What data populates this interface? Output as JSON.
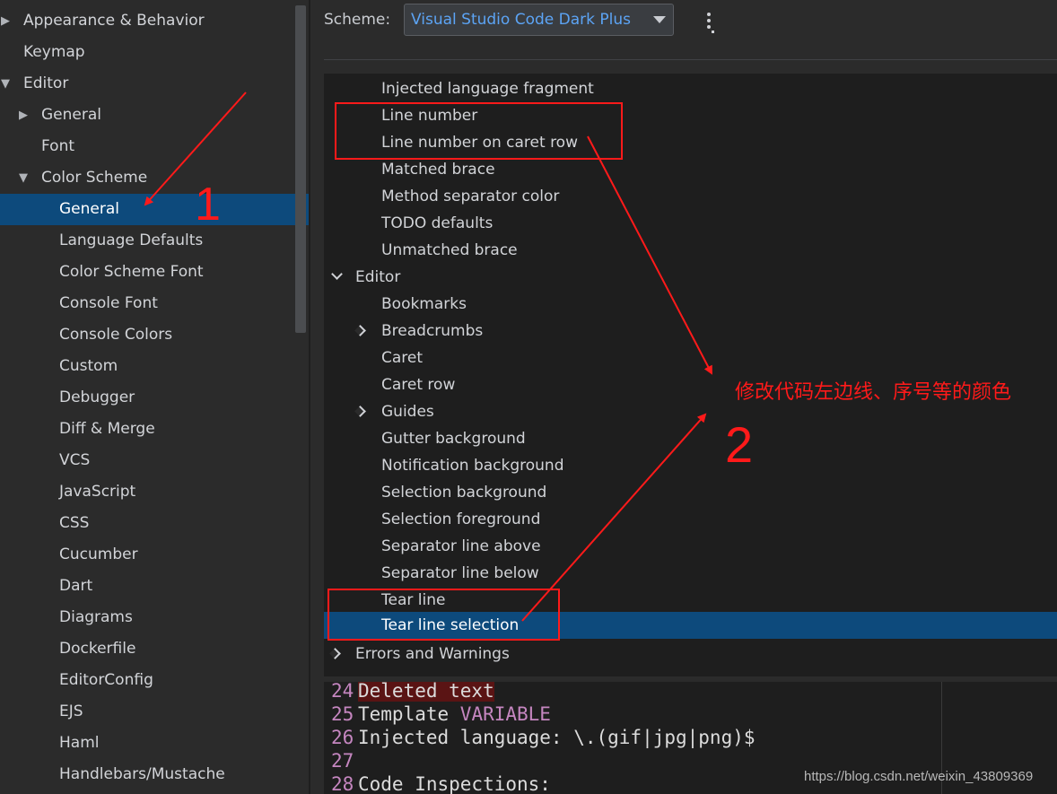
{
  "sidebar": {
    "items": [
      {
        "label": "Appearance & Behavior",
        "arrow": "▶"
      },
      {
        "label": "Keymap",
        "arrow": ""
      },
      {
        "label": "Editor",
        "arrow": "▼"
      },
      {
        "label": "General",
        "arrow": "▶"
      },
      {
        "label": "Font",
        "arrow": ""
      },
      {
        "label": "Color Scheme",
        "arrow": "▼"
      },
      {
        "label": "General",
        "arrow": "",
        "selected": true
      },
      {
        "label": "Language Defaults",
        "arrow": ""
      },
      {
        "label": "Color Scheme Font",
        "arrow": ""
      },
      {
        "label": "Console Font",
        "arrow": ""
      },
      {
        "label": "Console Colors",
        "arrow": ""
      },
      {
        "label": "Custom",
        "arrow": ""
      },
      {
        "label": "Debugger",
        "arrow": ""
      },
      {
        "label": "Diff & Merge",
        "arrow": ""
      },
      {
        "label": "VCS",
        "arrow": ""
      },
      {
        "label": "JavaScript",
        "arrow": ""
      },
      {
        "label": "CSS",
        "arrow": ""
      },
      {
        "label": "Cucumber",
        "arrow": ""
      },
      {
        "label": "Dart",
        "arrow": ""
      },
      {
        "label": "Diagrams",
        "arrow": ""
      },
      {
        "label": "Dockerfile",
        "arrow": ""
      },
      {
        "label": "EditorConfig",
        "arrow": ""
      },
      {
        "label": "EJS",
        "arrow": ""
      },
      {
        "label": "Haml",
        "arrow": ""
      },
      {
        "label": "Handlebars/Mustache",
        "arrow": ""
      }
    ]
  },
  "scheme": {
    "label": "Scheme:",
    "value": "Visual Studio Code Dark Plus"
  },
  "tree": {
    "items": [
      {
        "label": "Injected language fragment"
      },
      {
        "label": "Line number"
      },
      {
        "label": "Line number on caret row"
      },
      {
        "label": "Matched brace"
      },
      {
        "label": "Method separator color"
      },
      {
        "label": "TODO defaults"
      },
      {
        "label": "Unmatched brace"
      },
      {
        "label": "Editor",
        "chevron": "down"
      },
      {
        "label": "Bookmarks"
      },
      {
        "label": "Breadcrumbs",
        "chevron": "right"
      },
      {
        "label": "Caret"
      },
      {
        "label": "Caret row"
      },
      {
        "label": "Guides",
        "chevron": "right"
      },
      {
        "label": "Gutter background"
      },
      {
        "label": "Notification background"
      },
      {
        "label": "Selection background"
      },
      {
        "label": "Selection foreground"
      },
      {
        "label": "Separator line above"
      },
      {
        "label": "Separator line below"
      },
      {
        "label": "Tear line"
      },
      {
        "label": "Tear line selection",
        "selected": true
      },
      {
        "label": "Errors and Warnings",
        "chevron": "right"
      }
    ]
  },
  "preview": {
    "lines": [
      {
        "num": "24",
        "text": "Deleted text"
      },
      {
        "num": "25",
        "text": "Template ",
        "var": "VARIABLE"
      },
      {
        "num": "26",
        "text": "Injected language: \\.(gif|jpg|png)$"
      },
      {
        "num": "27",
        "text": ""
      },
      {
        "num": "28",
        "text": "Code Inspections:"
      }
    ]
  },
  "annotations": {
    "label1": "1",
    "label2": "2",
    "note": "修改代码左边线、序号等的颜色",
    "color": "#ff1a1a"
  },
  "watermark": "https://blog.csdn.net/weixin_43809369",
  "colors": {
    "selection": "#0d4a7c",
    "scheme_value": "#5ca4f5",
    "line_number": "#c586c0"
  }
}
